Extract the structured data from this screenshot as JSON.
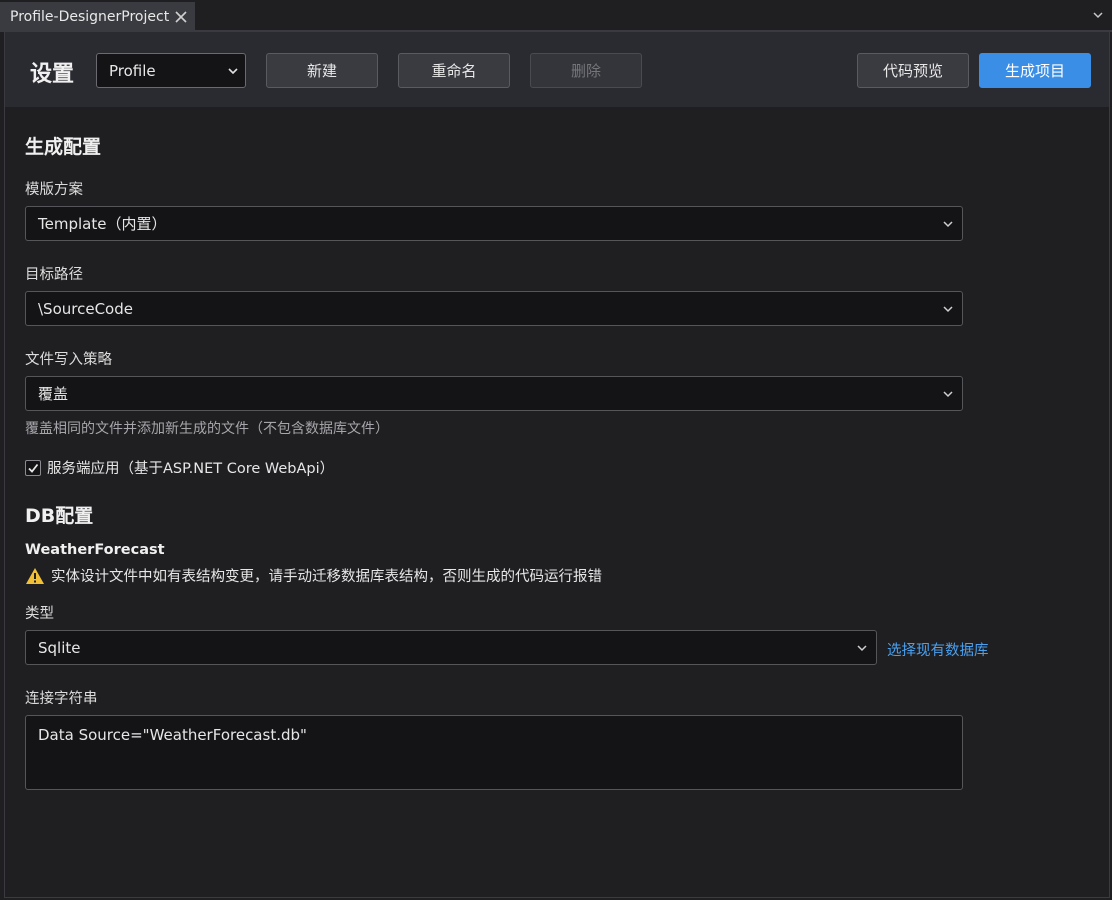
{
  "tab": {
    "title": "Profile-DesignerProject",
    "close_icon": "close-icon",
    "overflow_icon": "chevron-down-icon"
  },
  "toolbar": {
    "title": "设置",
    "profile_value": "Profile",
    "new_label": "新建",
    "rename_label": "重命名",
    "delete_label": "删除",
    "preview_label": "代码预览",
    "generate_label": "生成项目"
  },
  "gen_config": {
    "section_title": "生成配置",
    "template": {
      "label": "模版方案",
      "value": "Template（内置）"
    },
    "target_path": {
      "label": "目标路径",
      "value": "\\SourceCode"
    },
    "write_policy": {
      "label": "文件写入策略",
      "value": "覆盖",
      "hint": "覆盖相同的文件并添加新生成的文件（不包含数据库文件）"
    },
    "server_app": {
      "label": "服务端应用（基于ASP.NET Core WebApi）",
      "checked": true
    }
  },
  "db_config": {
    "section_title": "DB配置",
    "entity_name": "WeatherForecast",
    "warning": "实体设计文件中如有表结构变更，请手动迁移数据库表结构，否则生成的代码运行报错",
    "type": {
      "label": "类型",
      "value": "Sqlite",
      "link": "选择现有数据库"
    },
    "connection": {
      "label": "连接字符串",
      "value": "Data Source=\"WeatherForecast.db\""
    }
  },
  "colors": {
    "accent": "#3a8ee6",
    "link": "#4aa0ef",
    "warning": "#f2c037",
    "background": "#1f1f22"
  }
}
